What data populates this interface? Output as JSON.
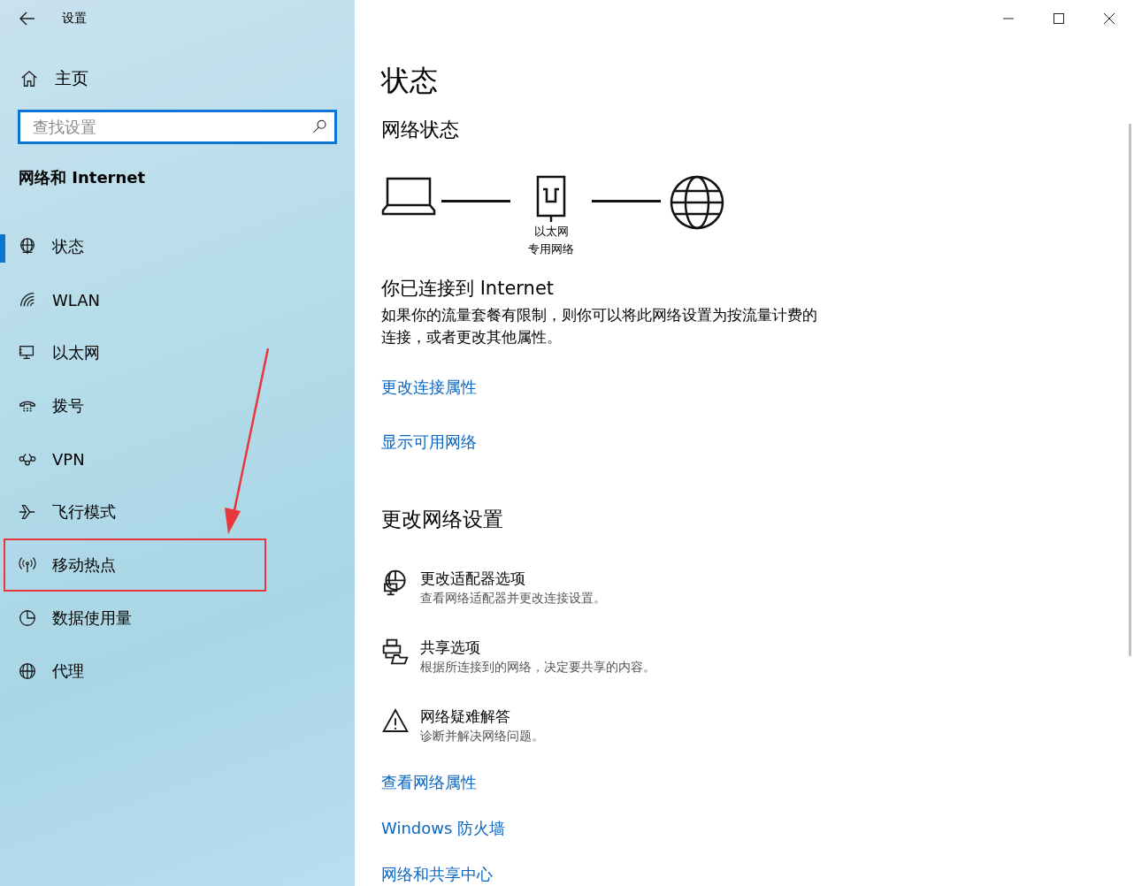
{
  "window": {
    "title": "设置"
  },
  "sidebar": {
    "home": "主页",
    "search": {
      "placeholder": "查找设置"
    },
    "section": "网络和 Internet",
    "items": [
      {
        "label": "状态",
        "kind": "status",
        "selected": true,
        "highlighted": false
      },
      {
        "label": "WLAN",
        "kind": "wifi",
        "selected": false,
        "highlighted": false
      },
      {
        "label": "以太网",
        "kind": "ethernet",
        "selected": false,
        "highlighted": false
      },
      {
        "label": "拨号",
        "kind": "dialup",
        "selected": false,
        "highlighted": false
      },
      {
        "label": "VPN",
        "kind": "vpn",
        "selected": false,
        "highlighted": false
      },
      {
        "label": "飞行模式",
        "kind": "airplane",
        "selected": false,
        "highlighted": false
      },
      {
        "label": "移动热点",
        "kind": "hotspot",
        "selected": false,
        "highlighted": true
      },
      {
        "label": "数据使用量",
        "kind": "data",
        "selected": false,
        "highlighted": false
      },
      {
        "label": "代理",
        "kind": "proxy",
        "selected": false,
        "highlighted": false
      }
    ]
  },
  "content": {
    "title": "状态",
    "network_status": {
      "heading": "网络状态",
      "adapter": "以太网",
      "profile": "专用网络"
    },
    "connected": {
      "heading": "你已连接到 Internet",
      "text": "如果你的流量套餐有限制，则你可以将此网络设置为按流量计费的连接，或者更改其他属性。"
    },
    "links_top": [
      "更改连接属性",
      "显示可用网络"
    ],
    "change_heading": "更改网络设置",
    "options": [
      {
        "kind": "adapter",
        "title": "更改适配器选项",
        "description": "查看网络适配器并更改连接设置。"
      },
      {
        "kind": "sharing",
        "title": "共享选项",
        "description": "根据所连接到的网络，决定要共享的内容。"
      },
      {
        "kind": "troubleshoot",
        "title": "网络疑难解答",
        "description": "诊断并解决网络问题。"
      }
    ],
    "links_bottom": [
      "查看网络属性",
      "Windows 防火墙",
      "网络和共享中心"
    ]
  }
}
